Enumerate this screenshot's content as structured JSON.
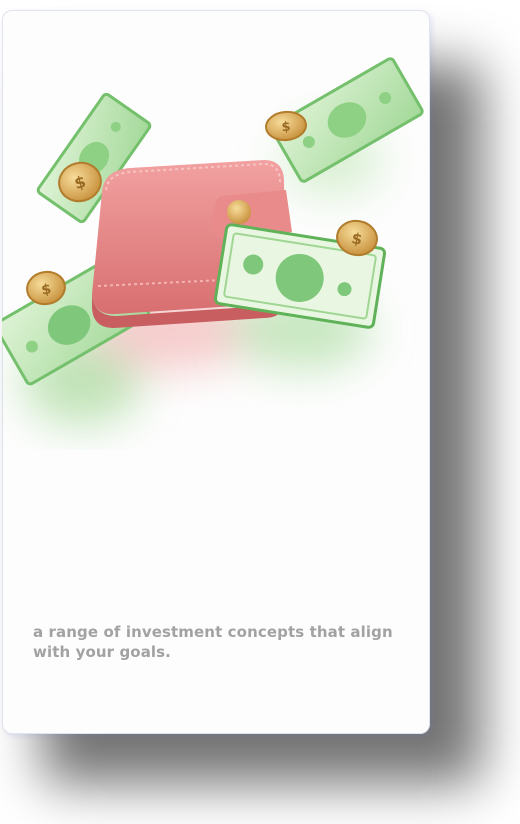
{
  "screen": {
    "illustration": {
      "subject": "wallet-with-money-icon",
      "colors": {
        "wallet": "#e88a8a",
        "bill": "#7fc77a",
        "coin": "#d7aa55"
      }
    },
    "description": "a range of investment concepts that align with your goals."
  }
}
